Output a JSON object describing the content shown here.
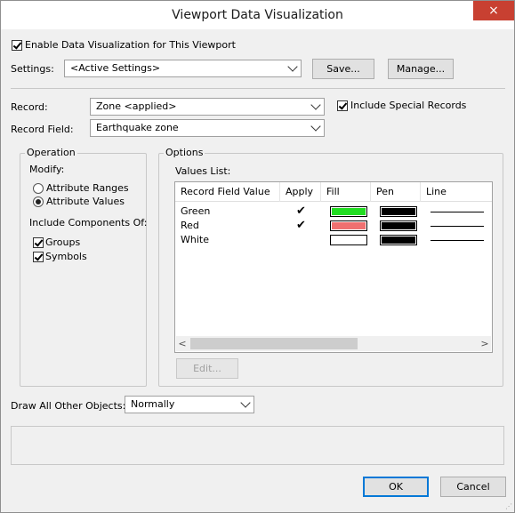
{
  "window": {
    "title": "Viewport Data Visualization",
    "close_label": "×"
  },
  "enable": {
    "label": "Enable Data Visualization for This Viewport",
    "checked": true
  },
  "settings": {
    "label": "Settings:",
    "value": "<Active Settings>",
    "save_label": "Save...",
    "manage_label": "Manage..."
  },
  "record": {
    "label": "Record:",
    "value": "Zone  <applied>",
    "include_special_label": "Include Special Records",
    "include_special_checked": true
  },
  "record_field": {
    "label": "Record Field:",
    "value": "Earthquake zone"
  },
  "operation": {
    "title": "Operation",
    "modify_label": "Modify:",
    "attribute_ranges_label": "Attribute Ranges",
    "attribute_values_label": "Attribute Values",
    "selected": "Attribute Values",
    "include_components_label": "Include Components Of:",
    "groups_label": "Groups",
    "groups_checked": true,
    "symbols_label": "Symbols",
    "symbols_checked": true
  },
  "options": {
    "title": "Options",
    "values_list_label": "Values List:",
    "columns": [
      "Record Field Value",
      "Apply",
      "Fill",
      "Pen",
      "Line"
    ],
    "rows": [
      {
        "value": "Green",
        "apply": true,
        "apply_mark": "✔",
        "fill": "#22dd22",
        "pen": "#000000"
      },
      {
        "value": "Red",
        "apply": true,
        "apply_mark": "✔",
        "fill": "#f07070",
        "pen": "#000000"
      },
      {
        "value": "White",
        "apply": false,
        "apply_mark": "",
        "fill": "#ffffff",
        "pen": "#000000"
      }
    ],
    "scroll_left": "<",
    "scroll_right": ">",
    "edit_label": "Edit..."
  },
  "draw_other": {
    "label": "Draw All Other Objects:",
    "value": "Normally"
  },
  "footer": {
    "ok_label": "OK",
    "cancel_label": "Cancel"
  }
}
